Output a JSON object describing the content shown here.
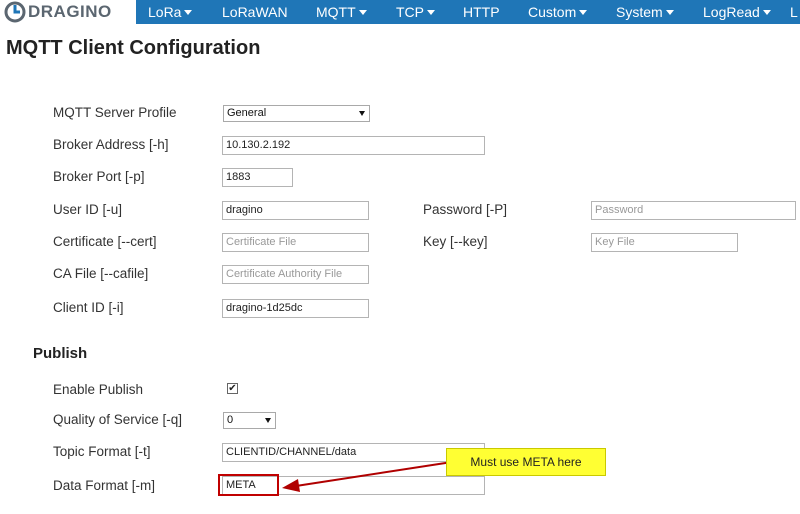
{
  "nav": {
    "brand": "DRAGINO",
    "items": [
      {
        "label": "LoRa",
        "dropdown": true
      },
      {
        "label": "LoRaWAN",
        "dropdown": false
      },
      {
        "label": "MQTT",
        "dropdown": true
      },
      {
        "label": "TCP",
        "dropdown": true
      },
      {
        "label": "HTTP",
        "dropdown": false
      },
      {
        "label": "Custom",
        "dropdown": true
      },
      {
        "label": "System",
        "dropdown": true
      },
      {
        "label": "LogRead",
        "dropdown": true
      },
      {
        "label": "L",
        "dropdown": false
      }
    ]
  },
  "page": {
    "title": "MQTT Client Configuration"
  },
  "fields": {
    "server_profile": {
      "label": "MQTT Server Profile",
      "value": "General"
    },
    "broker_address": {
      "label": "Broker Address [-h]",
      "value": "10.130.2.192"
    },
    "broker_port": {
      "label": "Broker Port [-p]",
      "value": "1883"
    },
    "user_id": {
      "label": "User ID [-u]",
      "value": "dragino"
    },
    "password": {
      "label": "Password [-P]",
      "placeholder": "Password"
    },
    "certificate": {
      "label": "Certificate [--cert]",
      "placeholder": "Certificate File"
    },
    "key": {
      "label": "Key [--key]",
      "placeholder": "Key File"
    },
    "ca_file": {
      "label": "CA File [--cafile]",
      "placeholder": "Certificate Authority File"
    },
    "client_id": {
      "label": "Client ID [-i]",
      "value": "dragino-1d25dc"
    }
  },
  "publish": {
    "title": "Publish",
    "enable": {
      "label": "Enable Publish",
      "checked": true,
      "mark": "✔"
    },
    "qos": {
      "label": "Quality of Service [-q]",
      "value": "0"
    },
    "topic_format": {
      "label": "Topic Format [-t]",
      "value": "CLIENTID/CHANNEL/data"
    },
    "data_format": {
      "label": "Data Format [-m]",
      "value": "META"
    }
  },
  "annotation": {
    "callout_text": "Must  use META here",
    "callout_color": "#ffff33",
    "arrow_color": "#b00000"
  }
}
